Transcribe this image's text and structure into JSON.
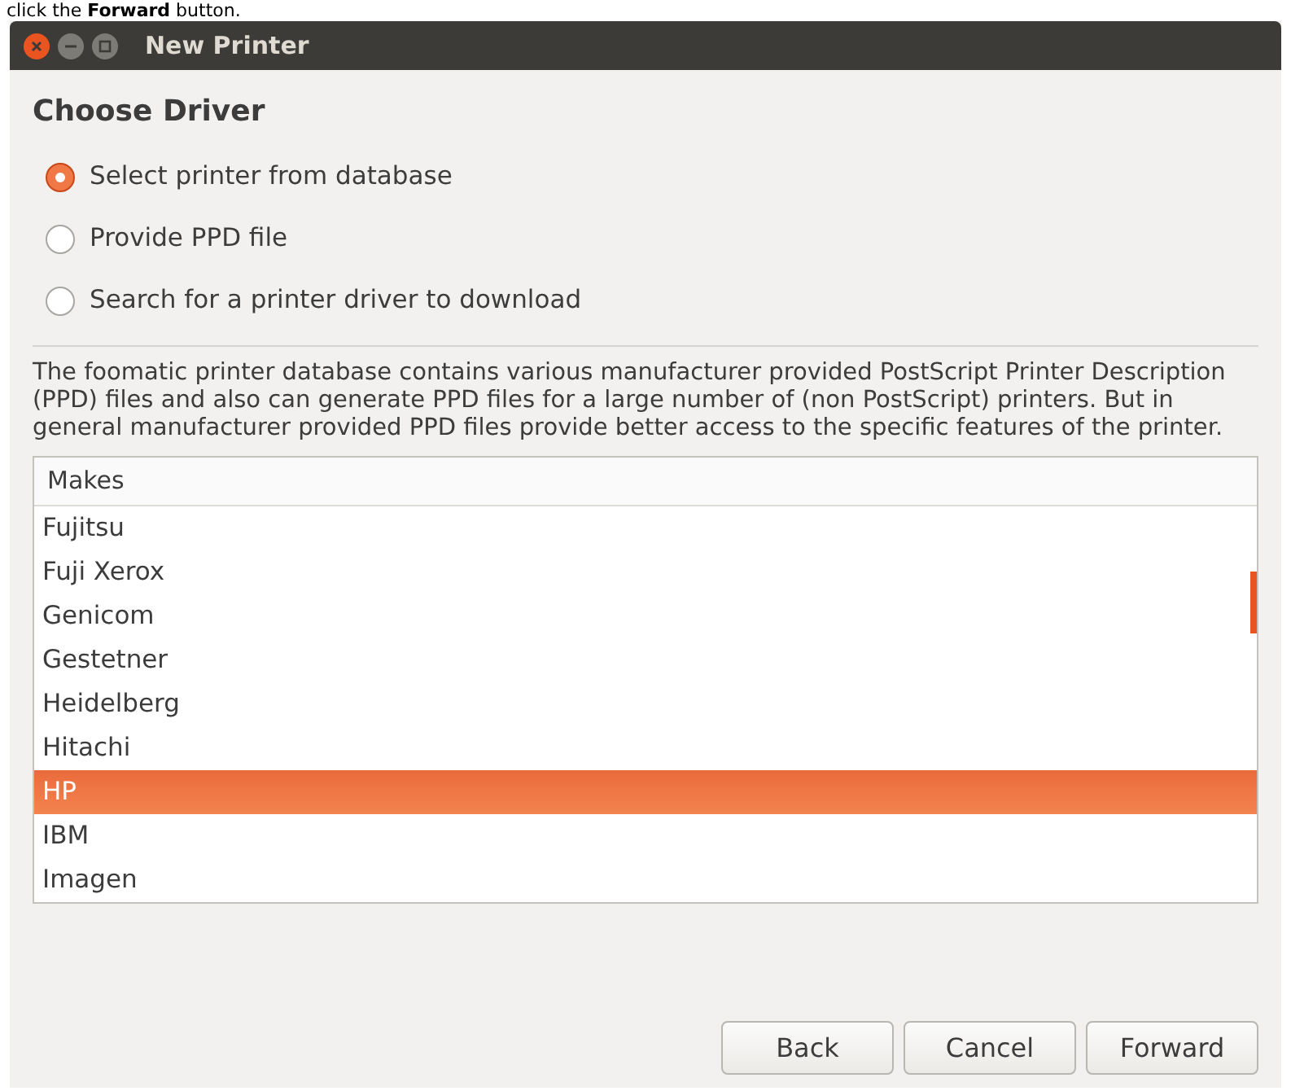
{
  "caption": "click the **Forward** button.",
  "window": {
    "title": "New Printer"
  },
  "heading": "Choose Driver",
  "options": [
    {
      "label": "Select printer from database",
      "selected": true
    },
    {
      "label": "Provide PPD file",
      "selected": false
    },
    {
      "label": "Search for a printer driver to download",
      "selected": false
    }
  ],
  "description": "The foomatic printer database contains various manufacturer provided PostScript Printer Description (PPD) files and also can generate PPD files for a large number of (non PostScript) printers. But in general manufacturer provided PPD files provide better access to the specific features of the printer.",
  "makes": {
    "column": "Makes",
    "rows": [
      {
        "label": "Fujitsu",
        "selected": false
      },
      {
        "label": "Fuji Xerox",
        "selected": false
      },
      {
        "label": "Genicom",
        "selected": false
      },
      {
        "label": "Gestetner",
        "selected": false
      },
      {
        "label": "Heidelberg",
        "selected": false
      },
      {
        "label": "Hitachi",
        "selected": false
      },
      {
        "label": "HP",
        "selected": true
      },
      {
        "label": "IBM",
        "selected": false
      },
      {
        "label": "Imagen",
        "selected": false
      }
    ]
  },
  "buttons": [
    "Back",
    "Cancel",
    "Forward"
  ]
}
